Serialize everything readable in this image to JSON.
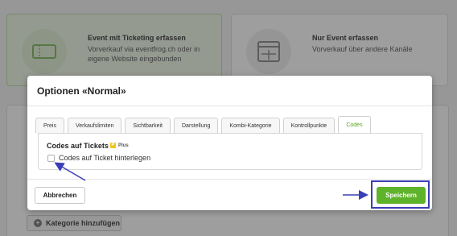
{
  "background": {
    "card_left": {
      "title": "Event mit Ticketing erfassen",
      "subtitle": "Vorverkauf via eventfrog.ch oder in eigene Website eingebunden",
      "icon": "ticket-icon"
    },
    "card_right": {
      "title": "Nur Event erfassen",
      "subtitle": "Vorverkauf über andere Kanäle",
      "icon": "calendar-icon"
    },
    "add_category_label": "Kategorie hinzufügen"
  },
  "modal": {
    "title": "Optionen «Normal»",
    "tabs": [
      {
        "label": "Preis",
        "active": false
      },
      {
        "label": "Verkaufslimiten",
        "active": false
      },
      {
        "label": "Sichtbarkeit",
        "active": false
      },
      {
        "label": "Darstellung",
        "active": false
      },
      {
        "label": "Kombi-Kategorie",
        "active": false
      },
      {
        "label": "Kontrollpunkte",
        "active": false
      },
      {
        "label": "Codes",
        "active": true
      }
    ],
    "section_title": "Codes auf Tickets",
    "plus_badge": "Plus",
    "checkbox_label": "Codes auf Ticket hinterlegen",
    "checkbox_checked": false,
    "cancel_label": "Abbrechen",
    "save_label": "Speichern"
  },
  "colors": {
    "accent_green": "#5fb32a",
    "annotation_blue": "#3a3fb5"
  }
}
